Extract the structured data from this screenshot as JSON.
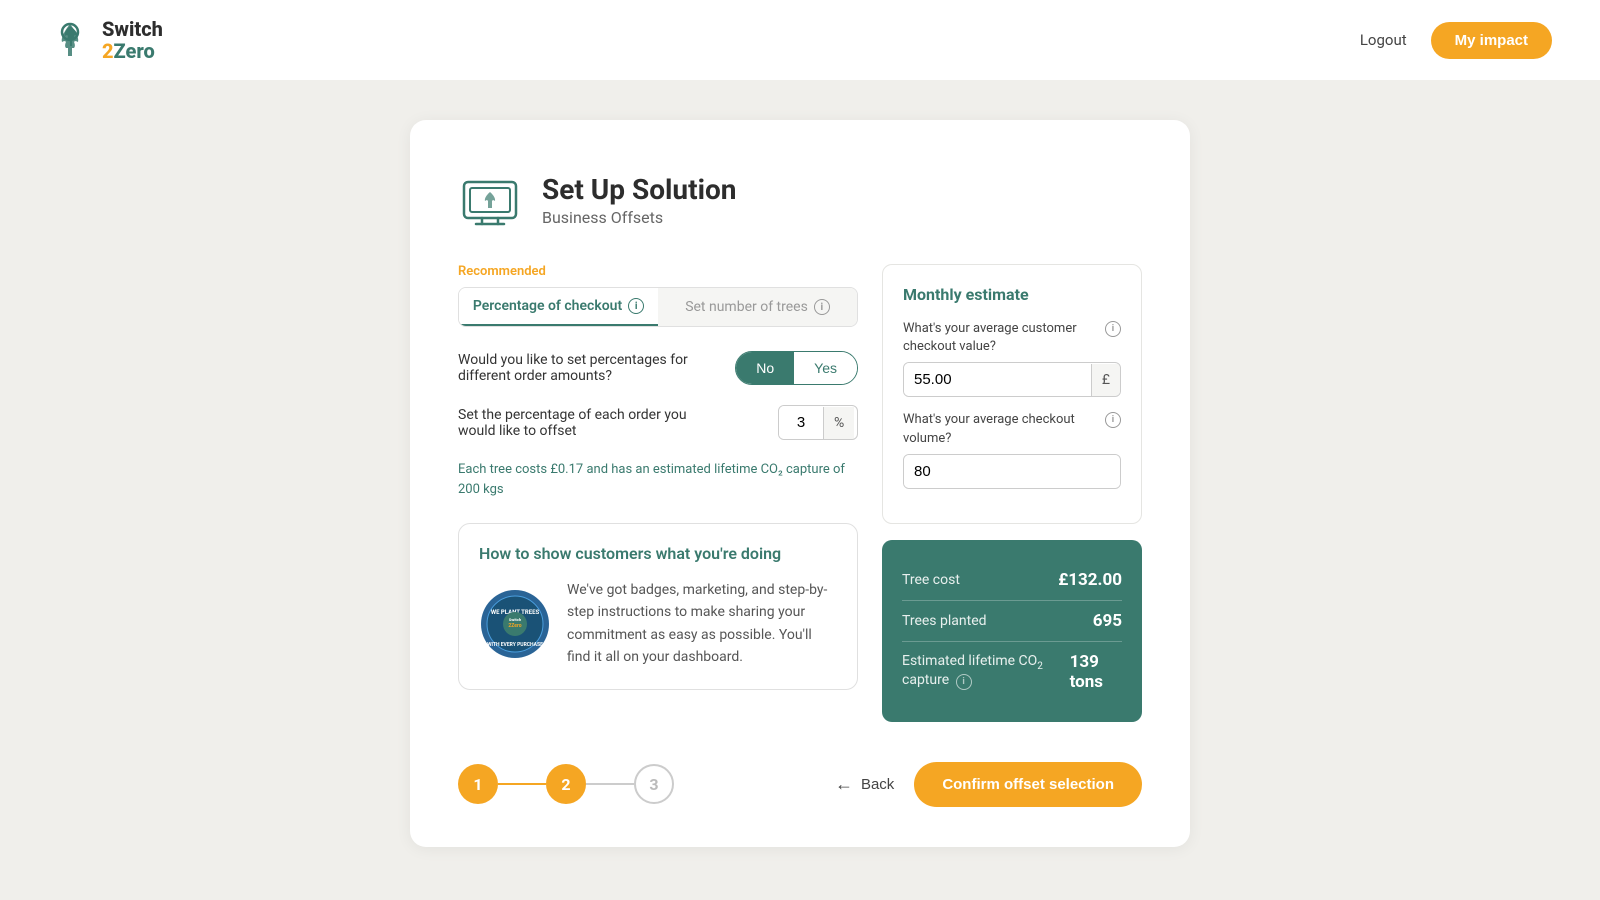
{
  "header": {
    "logo_line1": "Switch",
    "logo_line2": "2Zero",
    "logout_label": "Logout",
    "my_impact_label": "My impact"
  },
  "page": {
    "title": "Set Up Solution",
    "subtitle": "Business Offsets"
  },
  "tabs": {
    "recommended_label": "Recommended",
    "tab1_label": "Percentage of checkout",
    "tab2_label": "Set number of trees"
  },
  "form": {
    "question1_label": "Would you like to set percentages for different order amounts?",
    "no_label": "No",
    "yes_label": "Yes",
    "question2_label": "Set the percentage of each order you would like to offset",
    "percentage_value": "3",
    "percentage_symbol": "%",
    "info_text": "Each tree costs £0.17 and has an estimated lifetime CO₂ capture of 200 kgs"
  },
  "customers_section": {
    "title": "How to show customers what you're doing",
    "body_text": "We've got badges, marketing, and step-by-step instructions to make sharing your commitment as easy as possible. You'll find it all on your dashboard."
  },
  "monthly_estimate": {
    "title": "Monthly estimate",
    "q1_label": "What's your average customer checkout value?",
    "q1_value": "55.00",
    "q1_symbol": "£",
    "q2_label": "What's your average checkout volume?",
    "q2_value": "80",
    "tree_cost_label": "Tree cost",
    "tree_cost_value": "£132.00",
    "trees_planted_label": "Trees planted",
    "trees_planted_value": "695",
    "co2_label": "Estimated lifetime CO₂ capture",
    "co2_value": "139 tons"
  },
  "footer": {
    "step1_label": "1",
    "step2_label": "2",
    "step3_label": "3",
    "back_label": "Back",
    "confirm_label": "Confirm offset selection"
  }
}
